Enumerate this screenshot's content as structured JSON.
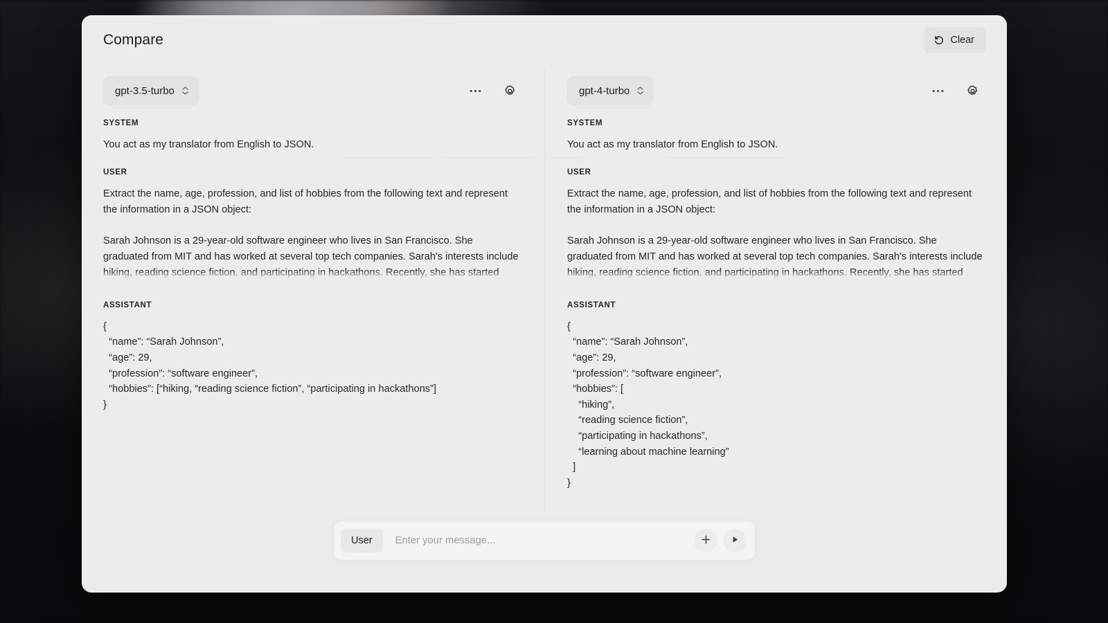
{
  "header": {
    "title": "Compare",
    "clear_label": "Clear",
    "clear_icon": "reset-counterclockwise-icon"
  },
  "panes": [
    {
      "id": "left",
      "model": "gpt-3.5-turbo",
      "more_icon": "ellipsis-icon",
      "settings_icon": "gear-icon",
      "messages": [
        {
          "role": "SYSTEM",
          "text": "You act as my translator from English to JSON."
        },
        {
          "role": "USER",
          "text": "Extract the name, age, profession, and list of hobbies from the following text and represent the information in a JSON object:\n\nSarah Johnson is a 29-year-old software engineer who lives in San Francisco. She graduated from MIT and has worked at several top tech companies. Sarah's interests include hiking, reading science fiction, and participating in hackathons. Recently, she has started learning about Python and machine learning to enhance her software engineering skills."
        },
        {
          "role": "ASSISTANT",
          "text": "{\n  “name”: “Sarah Johnson”,\n  “age”: 29,\n  “profession”: “software engineer”,\n  “hobbies”: [“hiking, “reading science fiction”, “participating in hackathons”]\n}"
        }
      ]
    },
    {
      "id": "right",
      "model": "gpt-4-turbo",
      "more_icon": "ellipsis-icon",
      "settings_icon": "gear-icon",
      "messages": [
        {
          "role": "SYSTEM",
          "text": "You act as my translator from English to JSON."
        },
        {
          "role": "USER",
          "text": "Extract the name, age, profession, and list of hobbies from the following text and represent the information in a JSON object:\n\nSarah Johnson is a 29-year-old software engineer who lives in San Francisco. She graduated from MIT and has worked at several top tech companies. Sarah's interests include hiking, reading science fiction, and participating in hackathons. Recently, she has started learning about Python and machine learning to enhance her software engineering skills."
        },
        {
          "role": "ASSISTANT",
          "text": "{\n  “name”: “Sarah Johnson”,\n  “age”: 29,\n  “profession”: “software engineer”,\n  “hobbies”: [\n    “hiking”,\n    “reading science fiction”,\n    “participating in hackathons”,\n    “learning about machine learning”\n  ]\n}"
        }
      ]
    }
  ],
  "composer": {
    "role_label": "User",
    "placeholder": "Enter your message...",
    "input_value": "",
    "add_icon": "plus-icon",
    "run_icon": "play-icon"
  },
  "colors": {
    "card_background": "#ececed",
    "page_background": "#0a0a0b",
    "text_primary": "#27272b",
    "control_background": "#e3e3e4"
  }
}
